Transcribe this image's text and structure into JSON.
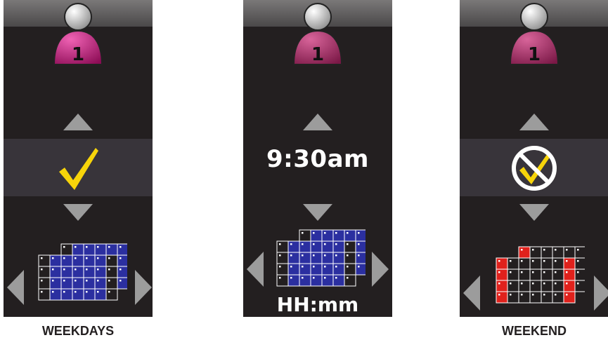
{
  "panels": [
    {
      "id": "weekdays",
      "user_number": "1",
      "status_icon": "checkmark-icon",
      "calendar_highlight": "weekdays",
      "caption": "WEEKDAYS"
    },
    {
      "id": "time",
      "user_number": "1",
      "time_value": "9:30am",
      "format_label": "HH:mm",
      "calendar_highlight": "weekdays"
    },
    {
      "id": "weekend",
      "user_number": "1",
      "status_icon": "no-check-icon",
      "calendar_highlight": "weekend",
      "caption": "WEEKEND"
    }
  ],
  "colors": {
    "panel_bg": "#231f20",
    "band_bg": "#38343a",
    "avatar_magenta": "#c2187b",
    "check_yellow": "#f7d40a",
    "weekday_blue": "#2b2fa0",
    "weekend_red": "#e0211c",
    "arrow_gray": "#9c9c9c"
  }
}
